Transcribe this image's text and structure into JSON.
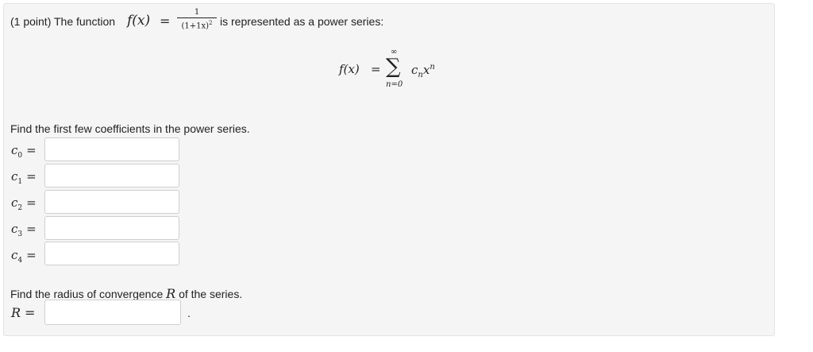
{
  "header": {
    "points": "(1 point) The function",
    "f_of_x": "f(x)",
    "equals": "=",
    "numerator": "1",
    "denominator_base": "(1+1x)",
    "denominator_exp": "2",
    "suffix": "is represented as a power series:"
  },
  "series": {
    "lhs": "f(x)",
    "equals": "=",
    "sigma": "∑",
    "upper": "∞",
    "lower": "n=0",
    "term_c": "c",
    "term_c_sub": "n",
    "term_x": "x",
    "term_x_sup": "n"
  },
  "coefficients": {
    "prompt": "Find the first few coefficients in the power series.",
    "rows": [
      {
        "var": "c",
        "sub": "0",
        "eq": "=",
        "value": ""
      },
      {
        "var": "c",
        "sub": "1",
        "eq": "=",
        "value": ""
      },
      {
        "var": "c",
        "sub": "2",
        "eq": "=",
        "value": ""
      },
      {
        "var": "c",
        "sub": "3",
        "eq": "=",
        "value": ""
      },
      {
        "var": "c",
        "sub": "4",
        "eq": "=",
        "value": ""
      }
    ]
  },
  "radius": {
    "prompt_before": "Find the radius of convergence",
    "symbol": "R",
    "prompt_after": "of the series.",
    "label": "R",
    "eq": "=",
    "value": "",
    "trailing": "."
  }
}
